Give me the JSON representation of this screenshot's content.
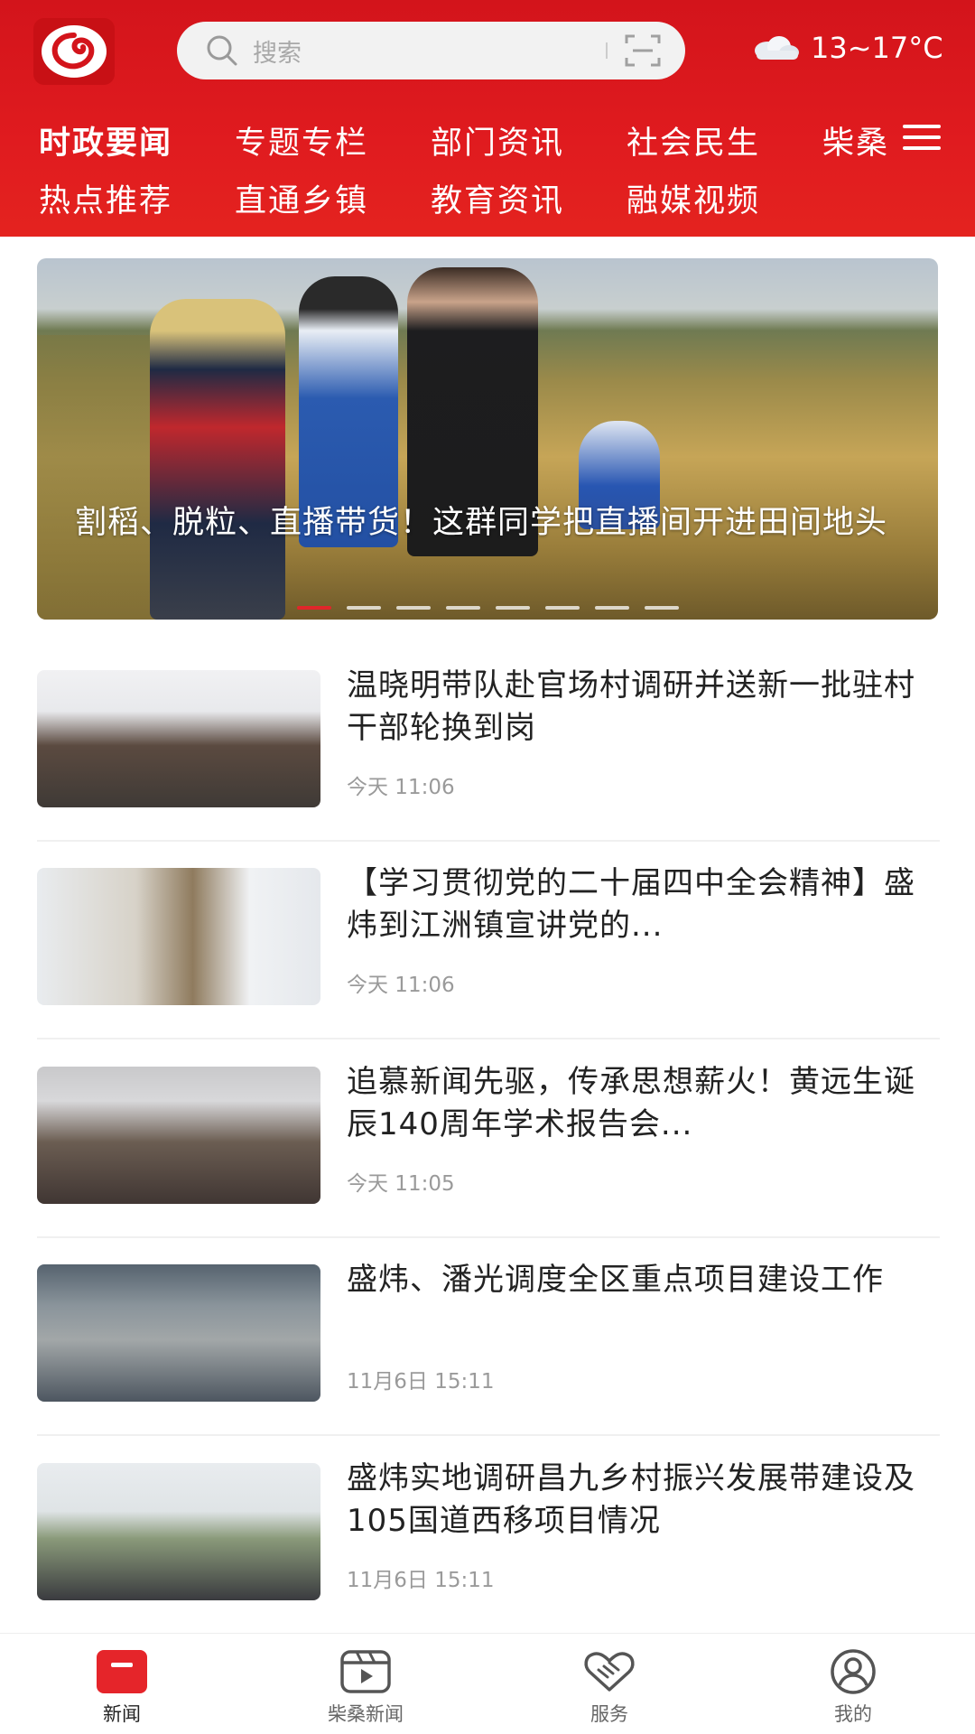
{
  "header": {
    "search_placeholder": "搜索",
    "weather": {
      "icon": "cloud-icon",
      "temperature": "13~17°C"
    },
    "nav_row1": [
      "时政要闻",
      "专题专栏",
      "部门资讯",
      "社会民生",
      "柴桑"
    ],
    "nav_row2": [
      "热点推荐",
      "直通乡镇",
      "教育资讯",
      "融媒视频"
    ],
    "active_nav": "时政要闻"
  },
  "banner": {
    "title": "割稻、脱粒、直播带货！这群同学把直播间开进田间地头",
    "slide_count": 8,
    "active_slide": 1
  },
  "news": [
    {
      "title": "温晓明带队赴官场村调研并送新一批驻村干部轮换到岗",
      "time": "今天 11:06"
    },
    {
      "title": "【学习贯彻党的二十届四中全会精神】盛炜到江洲镇宣讲党的...",
      "time": "今天 11:06"
    },
    {
      "title": "追慕新闻先驱，传承思想薪火！黄远生诞辰140周年学术报告会...",
      "time": "今天 11:05"
    },
    {
      "title": "盛炜、潘光调度全区重点项目建设工作",
      "time": "11月6日 15:11"
    },
    {
      "title": "盛炜实地调研昌九乡村振兴发展带建设及105国道西移项目情况",
      "time": "11月6日 15:11"
    }
  ],
  "tabbar": [
    {
      "label": "新闻",
      "icon": "news-icon",
      "active": true
    },
    {
      "label": "柴桑新闻",
      "icon": "video-icon",
      "active": false
    },
    {
      "label": "服务",
      "icon": "handshake-icon",
      "active": false
    },
    {
      "label": "我的",
      "icon": "user-icon",
      "active": false
    }
  ],
  "colors": {
    "brand_red": "#e01b1f",
    "time_gray": "#9a9a9a"
  }
}
